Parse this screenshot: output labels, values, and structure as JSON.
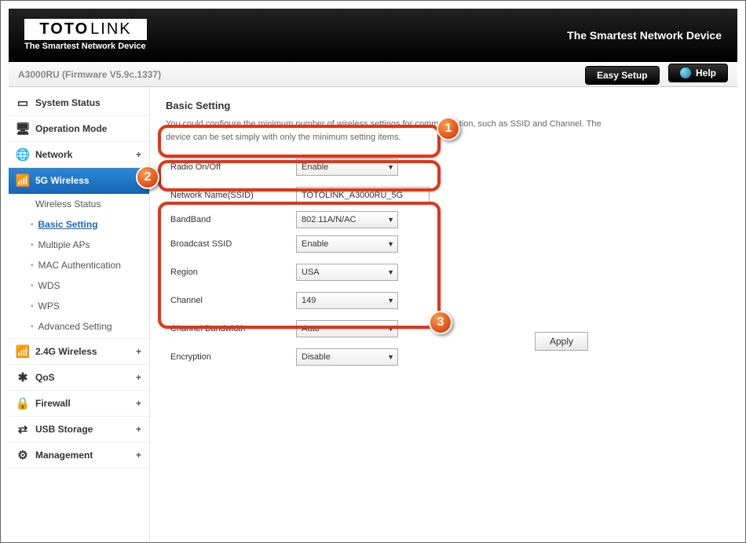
{
  "brand": {
    "name_bold": "TOTO",
    "name_light": "LINK",
    "subtitle": "The Smartest Network Device",
    "slogan": "The Smartest Network Device"
  },
  "topbar": {
    "firmware": "A3000RU (Firmware V5.9c.1337)",
    "easy_setup": "Easy Setup",
    "help": "Help"
  },
  "sidebar": {
    "items": [
      {
        "label": "System Status",
        "icon": "💬"
      },
      {
        "label": "Operation Mode",
        "icon": "⎙"
      },
      {
        "label": "Network",
        "icon": "🌐",
        "expand": "+"
      },
      {
        "label": "5G Wireless",
        "icon": "📶",
        "expand": "–",
        "active": true,
        "children": [
          {
            "label": "Wireless Status"
          },
          {
            "label": "Basic Setting",
            "selected": true
          },
          {
            "label": "Multiple APs"
          },
          {
            "label": "MAC Authentication"
          },
          {
            "label": "WDS"
          },
          {
            "label": "WPS"
          },
          {
            "label": "Advanced Setting"
          }
        ]
      },
      {
        "label": "2.4G Wireless",
        "icon": "📶",
        "expand": "+"
      },
      {
        "label": "QoS",
        "icon": "✱",
        "expand": "+"
      },
      {
        "label": "Firewall",
        "icon": "🔒",
        "expand": "+"
      },
      {
        "label": "USB Storage",
        "icon": "⇄",
        "expand": "+"
      },
      {
        "label": "Management",
        "icon": "⚙",
        "expand": "+"
      }
    ]
  },
  "page": {
    "title": "Basic Setting",
    "hint": "You could configure the minimum number of wireless settings for communication, such as SSID and Channel. The device can be set simply with only the minimum setting items.",
    "fields": {
      "radio": {
        "label": "Radio On/Off",
        "value": "Enable"
      },
      "ssid": {
        "label": "Network Name(SSID)",
        "value": "TOTOLINK_A3000RU_5G"
      },
      "band": {
        "label": "BandBand",
        "value": "802.11A/N/AC"
      },
      "broadcast": {
        "label": "Broadcast SSID",
        "value": "Enable"
      },
      "region": {
        "label": "Region",
        "value": "USA"
      },
      "channel": {
        "label": "Channel",
        "value": "149"
      },
      "bandwidth": {
        "label": "Channel Bandwidth",
        "value": "Auto"
      },
      "encryption": {
        "label": "Encryption",
        "value": "Disable"
      }
    },
    "apply": "Apply"
  },
  "annotations": {
    "n1": "1",
    "n2": "2",
    "n3": "3"
  }
}
